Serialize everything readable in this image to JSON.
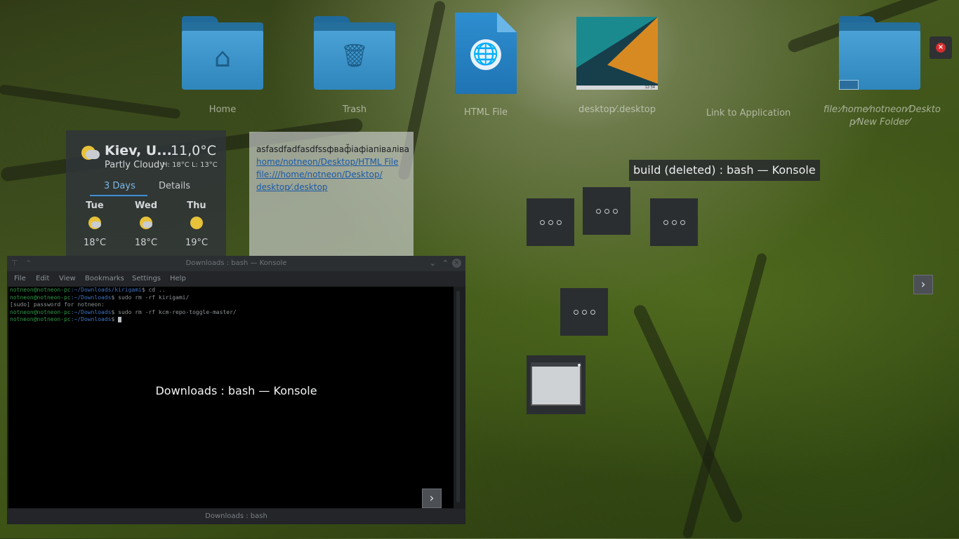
{
  "desktop": {
    "icons": [
      {
        "id": "home",
        "label": "Home",
        "glyph": "⌂",
        "icon": "home-folder-icon"
      },
      {
        "id": "trash",
        "label": "Trash",
        "glyph": "🗑",
        "icon": "trash-folder-icon"
      },
      {
        "id": "html",
        "label": "HTML File",
        "glyph": "🌐",
        "icon": "html-file-icon"
      },
      {
        "id": "desktop",
        "label": "desktop⁄.desktop",
        "icon": "desktop-file-thumbnail"
      },
      {
        "id": "link",
        "label": "Link to Application",
        "icon": "link-to-application-icon"
      },
      {
        "id": "newfolder",
        "label": "file:⁄home⁄notneon⁄Deskto p⁄New Folder⁄",
        "icon": "new-folder-link-icon"
      }
    ],
    "thumb_clock": "12:34"
  },
  "weather": {
    "city": "Kiev, U...",
    "temperature": "11,0°C",
    "condition": "Partly Cloudy",
    "high_low": "H: 18°C L: 13°C",
    "tabs": [
      "3 Days",
      "Details"
    ],
    "days": [
      {
        "name": "Tue",
        "temp": "18°C",
        "icon": "partly-cloudy"
      },
      {
        "name": "Wed",
        "temp": "18°C",
        "icon": "partly-cloudy"
      },
      {
        "name": "Thu",
        "temp": "19°C",
        "icon": "sunny"
      }
    ]
  },
  "notes": {
    "lines": [
      "asfasdfadfasdfssфваф̆іафіапіваліва",
      "home/notneon/Desktop/HTML File",
      "file:///home/notneon/Desktop/",
      "desktop⁄.desktop"
    ]
  },
  "konsole": {
    "title": "Downloads : bash — Konsole",
    "menu": [
      "File",
      "Edit",
      "View",
      "Bookmarks",
      "Settings",
      "Help"
    ],
    "terminal": [
      {
        "user": "notneon@notneon-pc",
        "path": ":~/Downloads/kirigami",
        "cmd": "$ cd .."
      },
      {
        "user": "notneon@notneon-pc",
        "path": ":~/Downloads",
        "cmd": "$ sudo rm -rf kirigami/"
      },
      {
        "user": "",
        "path": "",
        "cmd": "[sudo] password for notneon:"
      },
      {
        "user": "notneon@notneon-pc",
        "path": ":~/Downloads",
        "cmd": "$ sudo rm -rf kcm-repo-toggle-master/"
      },
      {
        "user": "notneon@notneon-pc",
        "path": ":~/Downloads",
        "cmd": "$ "
      }
    ],
    "status": "Downloads : bash",
    "caption": "Downloads : bash — Konsole"
  },
  "task_switcher": {
    "tooltip": "build (deleted) : bash — Konsole"
  },
  "arrows": {
    "right": "›"
  },
  "close": {
    "glyph": "×"
  }
}
